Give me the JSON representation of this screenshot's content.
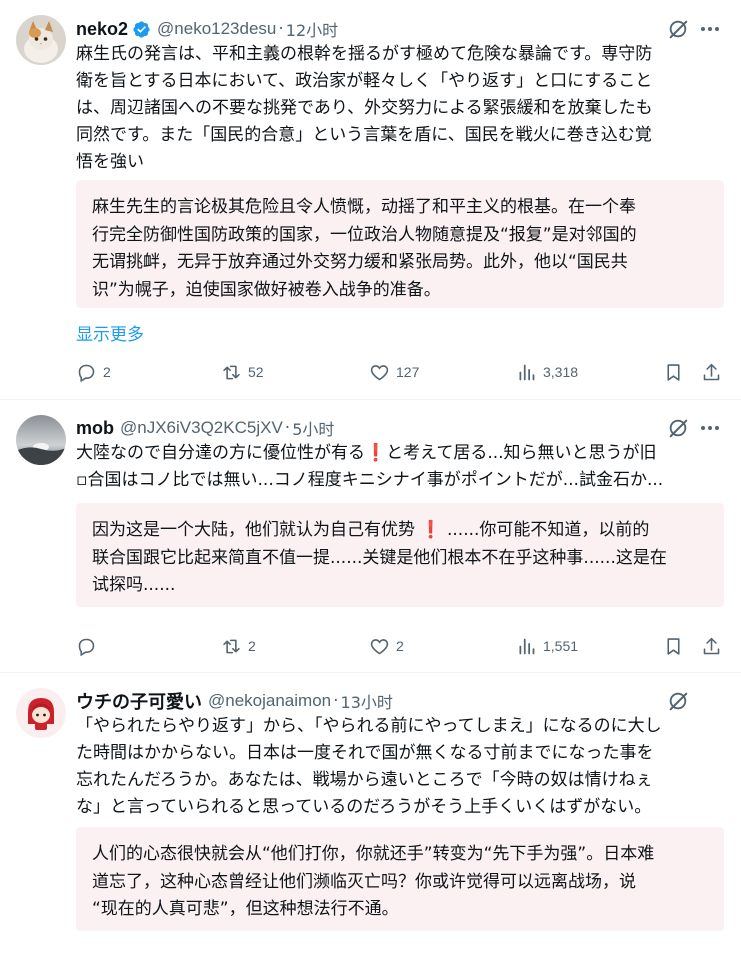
{
  "tweets": [
    {
      "author": "neko2",
      "handle": "@neko123desu",
      "time": "12小时",
      "verified": true,
      "text_lines": [
        "麻生氏の発言は、平和主義の根幹を揺るがす極めて危険な暴論です。専守防",
        "衛を旨とする日本において、政治家が軽々しく「やり返す」と口にすること",
        "は、周辺諸国への不要な挑発であり、外交努力による緊張緩和を放棄したも",
        "同然です。また「国民的合意」という言葉を盾に、国民を戦火に巻き込む覚",
        "悟を強い"
      ],
      "translation_lines": [
        "麻生先生的言论极其危险且令人愤慨，动摇了和平主义的根基。在一个奉",
        "行完全防御性国防政策的国家，一位政治人物随意提及“报复”是对邻国的",
        "无谓挑衅，无异于放弃通过外交努力缓和紧张局势。此外，他以“国民共",
        "识”为幌子，迫使国家做好被卷入战争的准备。"
      ],
      "show_more": "显示更多",
      "replies": "2",
      "reposts": "52",
      "likes": "127",
      "views": "3,318"
    },
    {
      "author": "mob",
      "handle": "@nJX6iV3Q2KC5jXV",
      "time": "5小时",
      "text_lines": [
        "大陸なので自分達の方に優位性が有る",
        "と考えて居る...知ら無いと思うが旧",
        "▫合国はコノ比では無い...コノ程度キニシナイ事がポイントだが...試金石か..."
      ],
      "translation_lines": [
        "因为这是一个大陆，他们就认为自己有优势",
        "......你可能不知道，以前的",
        "联合国跟它比起来简直不值一提......关键是他们根本不在乎这种事......这是在",
        "试探吗......"
      ],
      "exclamation": "❗",
      "replies": "",
      "reposts": "2",
      "likes": "2",
      "views": "1,551"
    },
    {
      "author": "ウチの子可愛い",
      "handle": "@nekojanaimon",
      "time": "13小时",
      "text_lines": [
        "「やられたらやり返す」から、「やられる前にやってしまえ」になるのに大し",
        "た時間はかからない。日本は一度それで国が無くなる寸前までになった事を",
        "忘れたんだろうか。あなたは、戦場から遠いところで「今時の奴は情けねぇ",
        "な」と言っていられると思っているのだろうがそう上手くいくはずがない。"
      ],
      "translation_lines": [
        "人们的心态很快就会从“他们打你，你就还手”转变为“先下手为强”。日本难",
        "道忘了，这种心态曾经让他们濒临灭亡吗？你或许觉得可以远离战场，说",
        "“现在的人真可悲”，但这种想法行不通。"
      ]
    }
  ],
  "colors": {
    "accent": "#1d9bf0",
    "secondary_text": "#536471",
    "translation_bg": "#fcf1f2",
    "verified": "#1d9bf0"
  },
  "icons": [
    "verified-badge-icon",
    "grok-icon",
    "more-icon",
    "reply-icon",
    "repost-icon",
    "like-icon",
    "views-icon",
    "bookmark-icon",
    "share-icon"
  ]
}
